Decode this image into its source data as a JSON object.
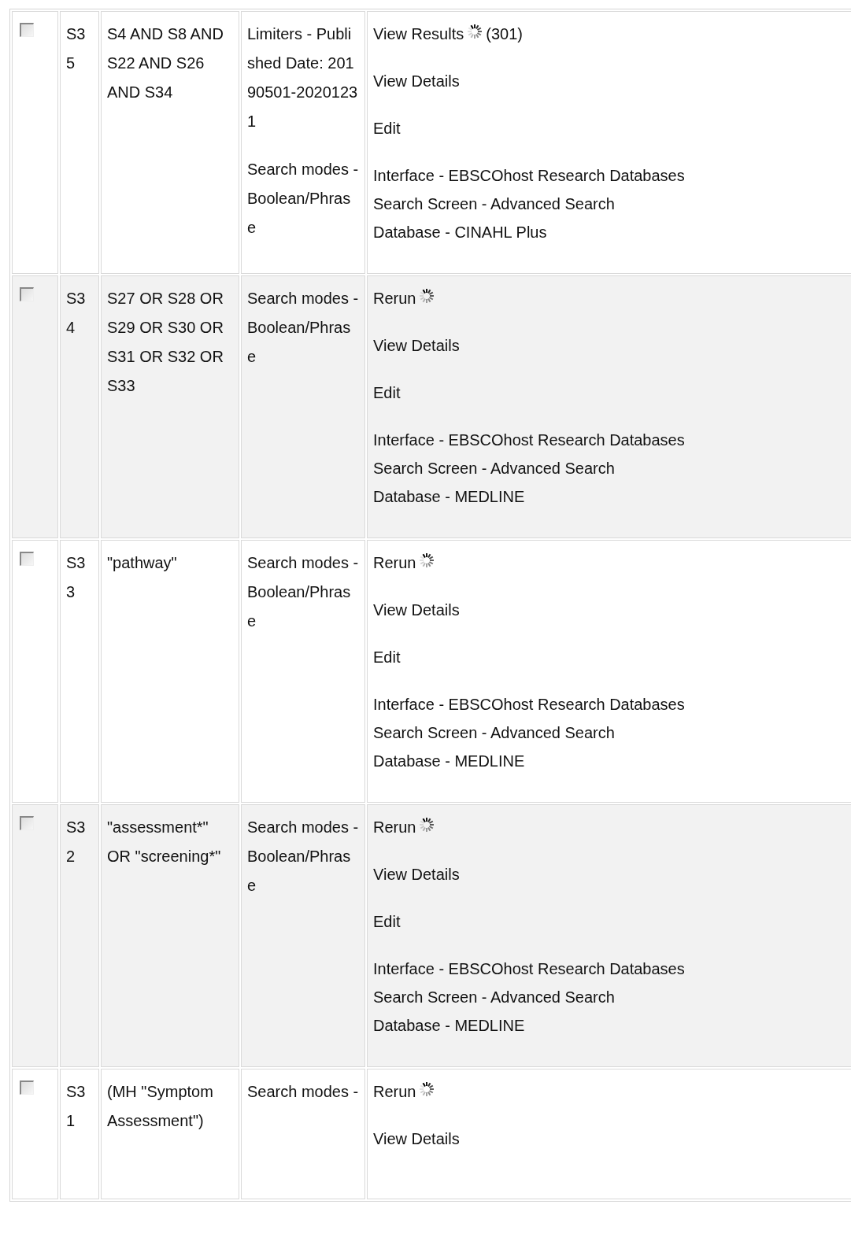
{
  "rows": [
    {
      "checked": false,
      "id": "S35",
      "terms": "S4 AND S8 AND S22 AND S26 AND S34",
      "options": [
        "Limiters - Published Date: 20190501-20201231",
        "Search modes - Boolean/Phrase"
      ],
      "action": {
        "label": "View Results",
        "count": "(301)"
      },
      "links": [
        "View Details",
        "Edit"
      ],
      "info": [
        "Interface - EBSCOhost Research Databases",
        "Search Screen - Advanced Search",
        "Database - CINAHL Plus"
      ]
    },
    {
      "checked": false,
      "id": "S34",
      "terms": "S27 OR S28 OR S29 OR S30 OR S31 OR S32 OR S33",
      "options": [
        "Search modes - Boolean/Phrase"
      ],
      "action": {
        "label": "Rerun"
      },
      "links": [
        "View Details",
        "Edit"
      ],
      "info": [
        "Interface - EBSCOhost Research Databases",
        "Search Screen - Advanced Search",
        "Database - MEDLINE"
      ]
    },
    {
      "checked": false,
      "id": "S33",
      "terms": "\"pathway\"",
      "options": [
        "Search modes - Boolean/Phrase"
      ],
      "action": {
        "label": "Rerun"
      },
      "links": [
        "View Details",
        "Edit"
      ],
      "info": [
        "Interface - EBSCOhost Research Databases",
        "Search Screen - Advanced Search",
        "Database - MEDLINE"
      ]
    },
    {
      "checked": false,
      "id": "S32",
      "terms": "\"assessment*\" OR \"screening*\"",
      "options": [
        "Search modes - Boolean/Phrase"
      ],
      "action": {
        "label": "Rerun"
      },
      "links": [
        "View Details",
        "Edit"
      ],
      "info": [
        "Interface - EBSCOhost Research Databases",
        "Search Screen - Advanced Search",
        "Database - MEDLINE"
      ]
    },
    {
      "checked": false,
      "id": "S31",
      "terms": "(MH \"Symptom Assessment\")",
      "options": [
        "Search modes -"
      ],
      "action": {
        "label": "Rerun"
      },
      "links": [
        "View Details"
      ],
      "info": []
    }
  ]
}
